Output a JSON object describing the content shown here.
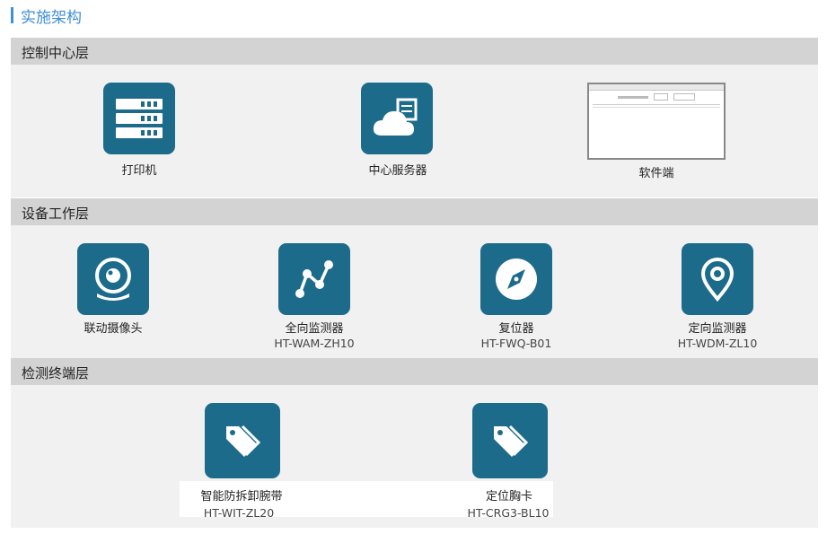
{
  "page": {
    "title": "实施架构"
  },
  "layers": {
    "control": {
      "label": "控制中心层",
      "items": [
        {
          "label": "打印机",
          "icon": "server-rack-icon"
        },
        {
          "label": "中心服务器",
          "icon": "cloud-server-icon"
        },
        {
          "label": "软件端",
          "icon": "software-window-screenshot"
        }
      ]
    },
    "device": {
      "label": "设备工作层",
      "items": [
        {
          "label": "联动摄像头",
          "model": "",
          "icon": "camera-icon"
        },
        {
          "label": "全向监测器",
          "model": "HT-WAM-ZH10",
          "icon": "network-nodes-icon"
        },
        {
          "label": "复位器",
          "model": "HT-FWQ-B01",
          "icon": "compass-icon"
        },
        {
          "label": "定向监测器",
          "model": "HT-WDM-ZL10",
          "icon": "location-pin-icon"
        }
      ]
    },
    "terminal": {
      "label": "检测终端层",
      "items": [
        {
          "label": "智能防拆卸腕带",
          "model": "HT-WIT-ZL20",
          "icon": "tag-icon"
        },
        {
          "label": "定位胸卡",
          "model": "HT-CRG3-BL10",
          "icon": "tag-icon"
        }
      ]
    }
  },
  "colors": {
    "accent": "#3f8fd9",
    "icon_bg": "#1d6b8b",
    "header_bg": "#d3d3d3",
    "body_bg": "#f1f1f1"
  }
}
